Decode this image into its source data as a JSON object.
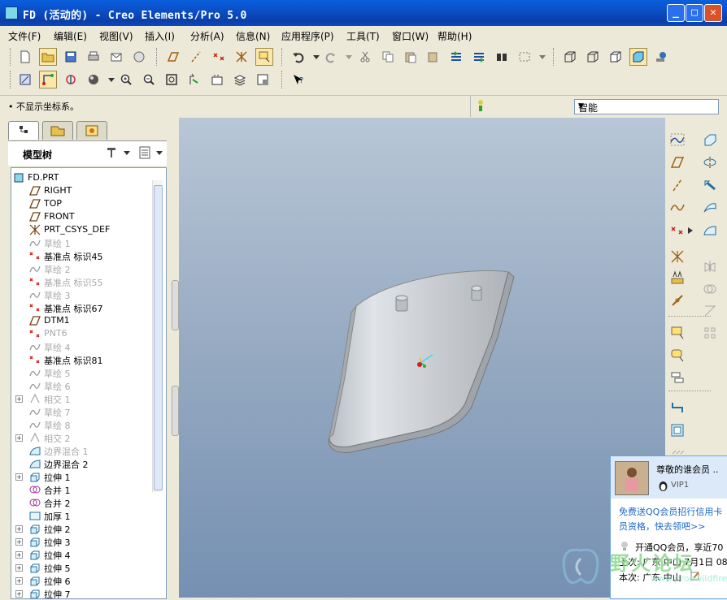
{
  "window": {
    "title": "FD (活动的) - Creo Elements/Pro 5.0"
  },
  "menu": [
    "文件(F)",
    "编辑(E)",
    "视图(V)",
    "插入(I)",
    "分析(A)",
    "信息(N)",
    "应用程序(P)",
    "工具(T)",
    "窗口(W)",
    "帮助(H)"
  ],
  "status": {
    "message": "• 不显示坐标系。",
    "filter": "智能"
  },
  "panel": {
    "title": "模型树"
  },
  "tree": [
    {
      "label": "FD.PRT",
      "icon": "part-icon",
      "dim": false,
      "expand": false
    },
    {
      "label": "RIGHT",
      "icon": "datum-plane-icon",
      "dim": false,
      "expand": false
    },
    {
      "label": "TOP",
      "icon": "datum-plane-icon",
      "dim": false,
      "expand": false
    },
    {
      "label": "FRONT",
      "icon": "datum-plane-icon",
      "dim": false,
      "expand": false
    },
    {
      "label": "PRT_CSYS_DEF",
      "icon": "csys-icon",
      "dim": false,
      "expand": false
    },
    {
      "label": "草绘 1",
      "icon": "sketch-icon",
      "dim": true,
      "expand": false
    },
    {
      "label": "基准点 标识45",
      "icon": "datum-point-icon",
      "dim": false,
      "expand": false
    },
    {
      "label": "草绘 2",
      "icon": "sketch-icon",
      "dim": true,
      "expand": false
    },
    {
      "label": "基准点 标识55",
      "icon": "datum-point-icon",
      "dim": true,
      "expand": false
    },
    {
      "label": "草绘 3",
      "icon": "sketch-icon",
      "dim": true,
      "expand": false
    },
    {
      "label": "基准点 标识67",
      "icon": "datum-point-icon",
      "dim": false,
      "expand": false
    },
    {
      "label": "DTM1",
      "icon": "datum-plane-icon",
      "dim": false,
      "expand": false
    },
    {
      "label": "PNT6",
      "icon": "datum-point-icon",
      "dim": true,
      "expand": false
    },
    {
      "label": "草绘 4",
      "icon": "sketch-icon",
      "dim": true,
      "expand": false
    },
    {
      "label": "基准点 标识81",
      "icon": "datum-point-icon",
      "dim": false,
      "expand": false
    },
    {
      "label": "草绘 5",
      "icon": "sketch-icon",
      "dim": true,
      "expand": false
    },
    {
      "label": "草绘 6",
      "icon": "sketch-icon",
      "dim": true,
      "expand": false
    },
    {
      "label": "相交 1",
      "icon": "intersect-icon",
      "dim": true,
      "expand": true
    },
    {
      "label": "草绘 7",
      "icon": "sketch-icon",
      "dim": true,
      "expand": false
    },
    {
      "label": "草绘 8",
      "icon": "sketch-icon",
      "dim": true,
      "expand": false
    },
    {
      "label": "相交 2",
      "icon": "intersect-icon",
      "dim": true,
      "expand": true
    },
    {
      "label": "边界混合 1",
      "icon": "boundary-blend-icon",
      "dim": true,
      "expand": false
    },
    {
      "label": "边界混合 2",
      "icon": "boundary-blend-icon",
      "dim": false,
      "expand": false
    },
    {
      "label": "拉伸 1",
      "icon": "extrude-icon",
      "dim": false,
      "expand": true
    },
    {
      "label": "合并 1",
      "icon": "merge-icon",
      "dim": false,
      "expand": false
    },
    {
      "label": "合并 2",
      "icon": "merge-icon",
      "dim": false,
      "expand": false
    },
    {
      "label": "加厚 1",
      "icon": "thicken-icon",
      "dim": false,
      "expand": false
    },
    {
      "label": "拉伸 2",
      "icon": "extrude-icon",
      "dim": false,
      "expand": true
    },
    {
      "label": "拉伸 3",
      "icon": "extrude-icon",
      "dim": false,
      "expand": true
    },
    {
      "label": "拉伸 4",
      "icon": "extrude-icon",
      "dim": false,
      "expand": true
    },
    {
      "label": "拉伸 5",
      "icon": "extrude-icon",
      "dim": false,
      "expand": true
    },
    {
      "label": "拉伸 6",
      "icon": "extrude-icon",
      "dim": false,
      "expand": true
    },
    {
      "label": "拉伸 7",
      "icon": "extrude-icon",
      "dim": false,
      "expand": true
    }
  ],
  "qq": {
    "name": "尊敬的谁会员 ..",
    "vip": "VIP1",
    "promo_line1": "免费送QQ会员招行信用卡",
    "promo_line2": "员资格，快去领吧>>",
    "info": "开通QQ会员，享近70",
    "last_login": "上次: 广东 中山 7月1日 08",
    "this_login": "本次: 广东 中山"
  },
  "watermark": {
    "text": "野火论坛",
    "url": "www.proewildfire.cn"
  }
}
